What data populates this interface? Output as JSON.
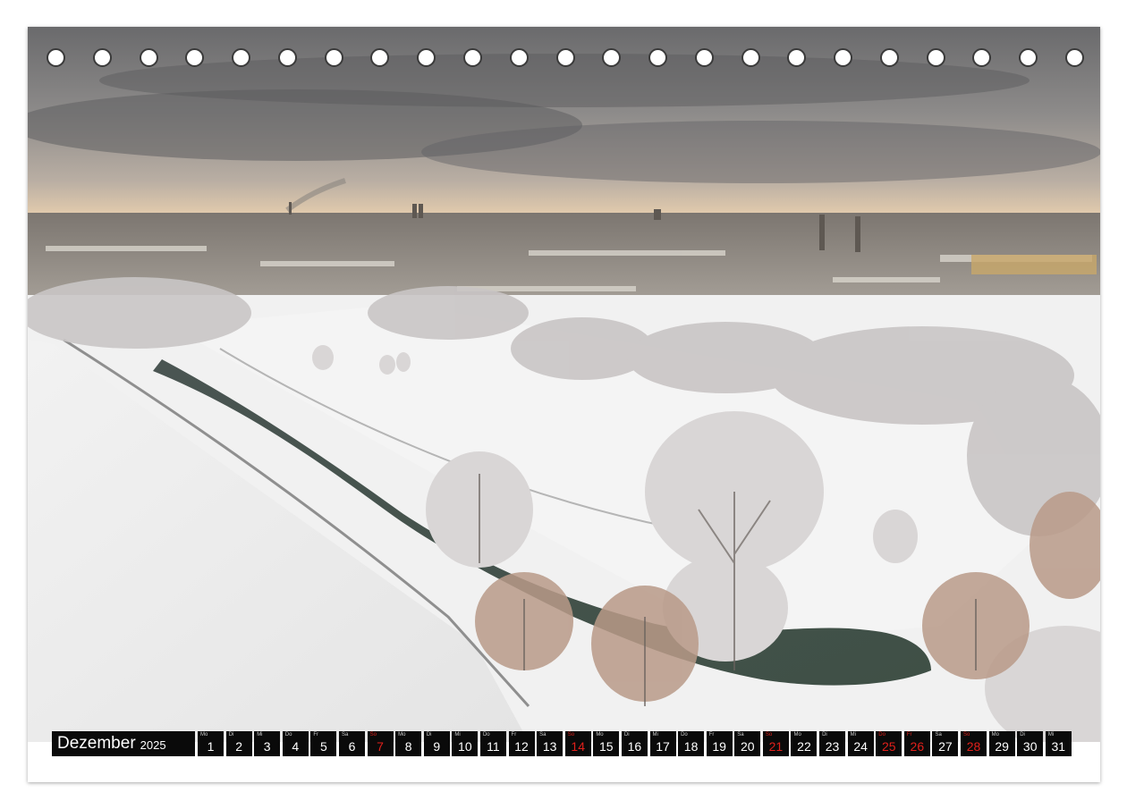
{
  "calendar": {
    "month": "Dezember",
    "year": "2025",
    "days": [
      {
        "wd": "Mo",
        "n": "1",
        "red": false
      },
      {
        "wd": "Di",
        "n": "2",
        "red": false
      },
      {
        "wd": "Mi",
        "n": "3",
        "red": false
      },
      {
        "wd": "Do",
        "n": "4",
        "red": false
      },
      {
        "wd": "Fr",
        "n": "5",
        "red": false
      },
      {
        "wd": "Sa",
        "n": "6",
        "red": false
      },
      {
        "wd": "So",
        "n": "7",
        "red": true
      },
      {
        "wd": "Mo",
        "n": "8",
        "red": false
      },
      {
        "wd": "Di",
        "n": "9",
        "red": false
      },
      {
        "wd": "Mi",
        "n": "10",
        "red": false
      },
      {
        "wd": "Do",
        "n": "11",
        "red": false
      },
      {
        "wd": "Fr",
        "n": "12",
        "red": false
      },
      {
        "wd": "Sa",
        "n": "13",
        "red": false
      },
      {
        "wd": "So",
        "n": "14",
        "red": true
      },
      {
        "wd": "Mo",
        "n": "15",
        "red": false
      },
      {
        "wd": "Di",
        "n": "16",
        "red": false
      },
      {
        "wd": "Mi",
        "n": "17",
        "red": false
      },
      {
        "wd": "Do",
        "n": "18",
        "red": false
      },
      {
        "wd": "Fr",
        "n": "19",
        "red": false
      },
      {
        "wd": "Sa",
        "n": "20",
        "red": false
      },
      {
        "wd": "So",
        "n": "21",
        "red": true
      },
      {
        "wd": "Mo",
        "n": "22",
        "red": false
      },
      {
        "wd": "Di",
        "n": "23",
        "red": false
      },
      {
        "wd": "Mi",
        "n": "24",
        "red": false
      },
      {
        "wd": "Do",
        "n": "25",
        "red": true
      },
      {
        "wd": "Fr",
        "n": "26",
        "red": true
      },
      {
        "wd": "Sa",
        "n": "27",
        "red": false
      },
      {
        "wd": "So",
        "n": "28",
        "red": true
      },
      {
        "wd": "Mo",
        "n": "29",
        "red": false
      },
      {
        "wd": "Di",
        "n": "30",
        "red": false
      },
      {
        "wd": "Mi",
        "n": "31",
        "red": false
      }
    ]
  },
  "binding_hole_count": 23,
  "colors": {
    "holiday_red": "#e0201b",
    "strip_bg": "#0a0a0a"
  }
}
